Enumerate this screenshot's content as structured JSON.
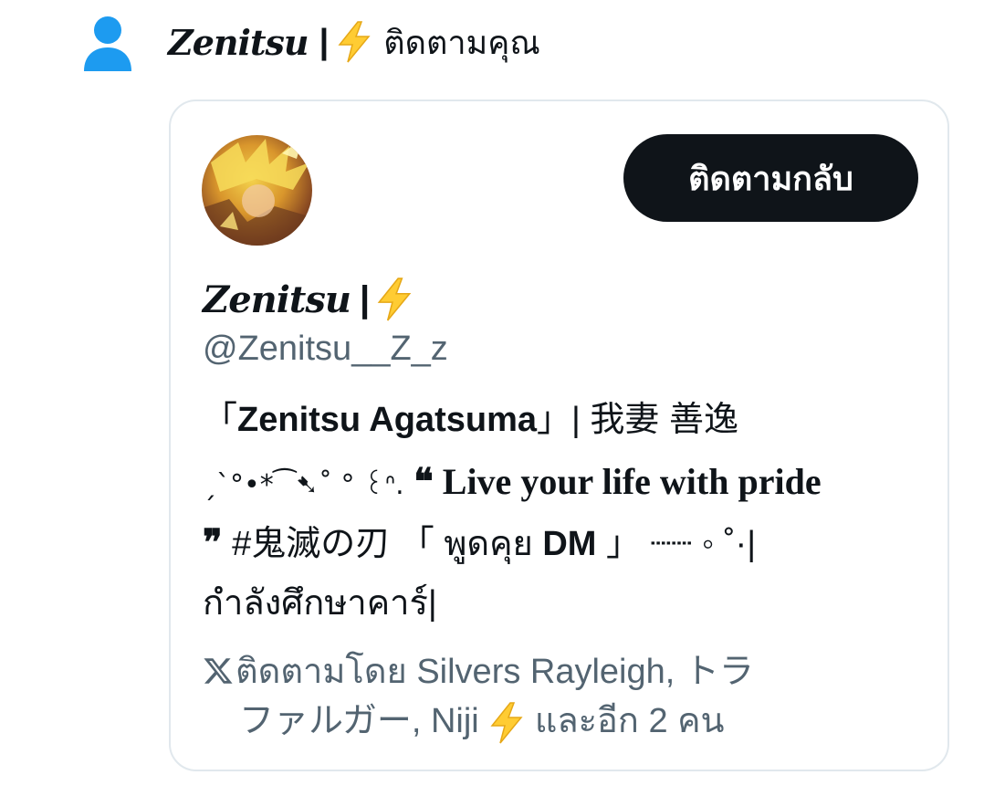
{
  "notification": {
    "user_icon": "user-icon",
    "name": "Zenitsu",
    "separator": "|",
    "emoji": "lightning-bolt-icon",
    "action_text": "ติดตามคุณ"
  },
  "card": {
    "avatar": "avatar",
    "follow_back_label": "ติดตามกลับ",
    "display_name": "Zenitsu",
    "display_name_separator": "|",
    "handle": "@Zenitsu__Z_z",
    "bio": {
      "line1_open": "「",
      "line1_name": "Zenitsu Agatsuma",
      "line1_close": "」| 我妻 善逸",
      "line2_deco": "ˏˋ°•*⁀➷˚ ° ꒰ᐢ.",
      "line2_quote_open": "❝",
      "line2_text": " Live your life with pride",
      "line3_quote_close": "❞",
      "line3_tag": " #鬼滅の刃 「 พูดคุย ",
      "line3_dm": "DM",
      "line3_end": " 」 ┈┈ ◦ ˚·|",
      "line4": "กำลังศึกษาคาร์|"
    },
    "followed_by": {
      "icon": "x-logo-icon",
      "line1": "ติดตามโดย Silvers Rayleigh, トラ",
      "line2_text": "ファルガー, Niji",
      "line2_emoji": "lightning-bolt-icon",
      "line2_end": " และอีก 2 คน"
    }
  },
  "colors": {
    "primary_text": "#0f1419",
    "secondary_text": "#536471",
    "user_icon": "#1d9bf0",
    "button_bg": "#0f1419",
    "button_text": "#ffffff",
    "bolt": "#ffcc33",
    "card_border": "#e1e8ed"
  }
}
